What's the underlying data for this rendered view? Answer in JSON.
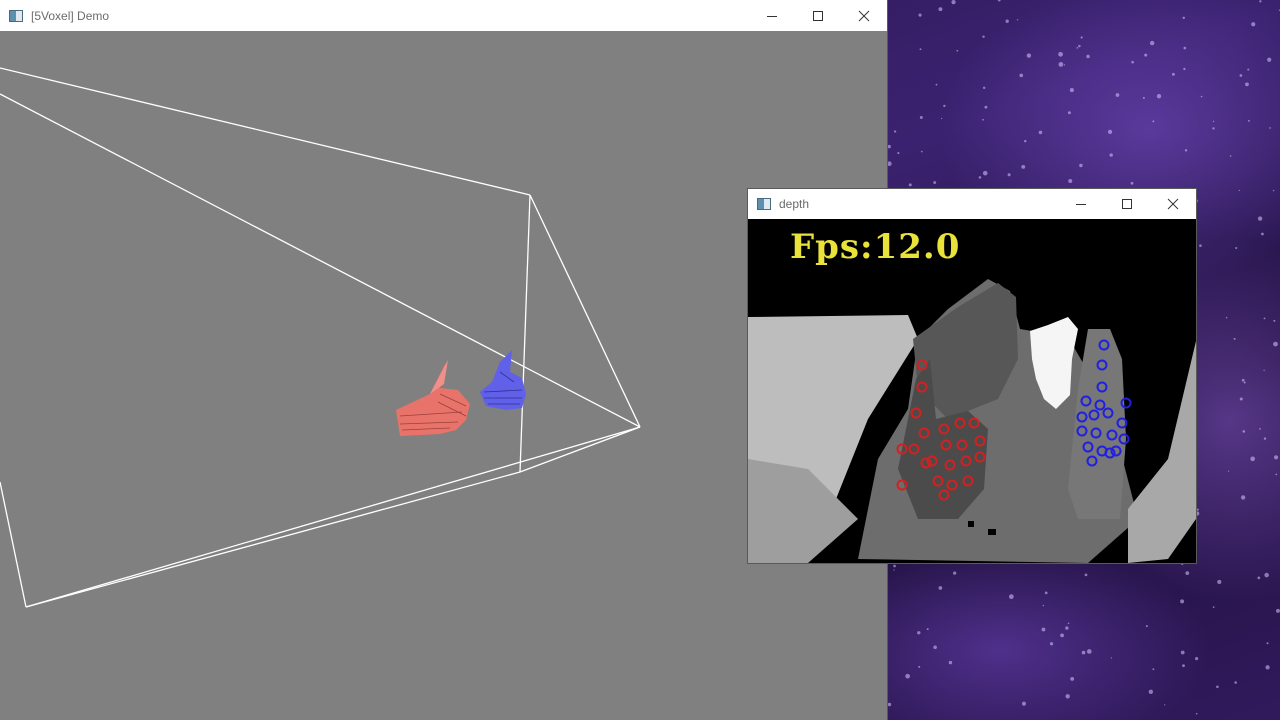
{
  "desktop": {
    "wallpaper": "purple-water-droplets"
  },
  "main_window": {
    "title": "[5Voxel] Demo",
    "icon": "app-window-icon",
    "controls": [
      "minimize-icon",
      "maximize-icon",
      "close-icon"
    ],
    "background_color": "#808080",
    "frustum_color": "#ffffff",
    "hands": [
      {
        "name": "left-hand",
        "color": "#e8736b"
      },
      {
        "name": "right-hand",
        "color": "#5b5be0"
      }
    ]
  },
  "depth_window": {
    "title": "depth",
    "icon": "app-window-icon",
    "controls": [
      "minimize-icon",
      "maximize-icon",
      "close-icon"
    ],
    "fps_label": "Fps:12.0",
    "fps_color": "#e8e23a",
    "keypoint_colors": {
      "left_hand": "#d42020",
      "right_hand": "#2020e0"
    }
  }
}
